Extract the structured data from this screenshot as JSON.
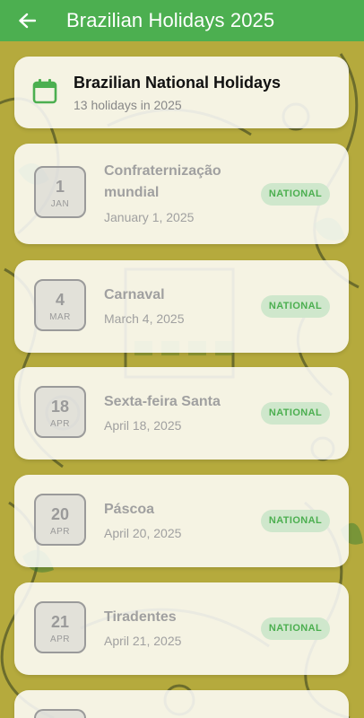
{
  "appbar": {
    "title": "Brazilian Holidays 2025",
    "back_icon": "arrow-left-icon"
  },
  "summary": {
    "title": "Brazilian National Holidays",
    "subtitle": "13 holidays in 2025",
    "icon": "calendar-icon"
  },
  "holidays": [
    {
      "day": "1",
      "month": "JAN",
      "name": "Confraternização mundial",
      "date": "January 1, 2025",
      "type": "NATIONAL"
    },
    {
      "day": "4",
      "month": "MAR",
      "name": "Carnaval",
      "date": "March 4, 2025",
      "type": "NATIONAL"
    },
    {
      "day": "18",
      "month": "APR",
      "name": "Sexta-feira Santa",
      "date": "April 18, 2025",
      "type": "NATIONAL"
    },
    {
      "day": "20",
      "month": "APR",
      "name": "Páscoa",
      "date": "April 20, 2025",
      "type": "NATIONAL"
    },
    {
      "day": "21",
      "month": "APR",
      "name": "Tiradentes",
      "date": "April 21, 2025",
      "type": "NATIONAL"
    }
  ],
  "colors": {
    "appbar": "#4caf50",
    "badge_bg": "#cfe7cc",
    "badge_text": "#4caf50",
    "background": "#b9ad3f"
  }
}
